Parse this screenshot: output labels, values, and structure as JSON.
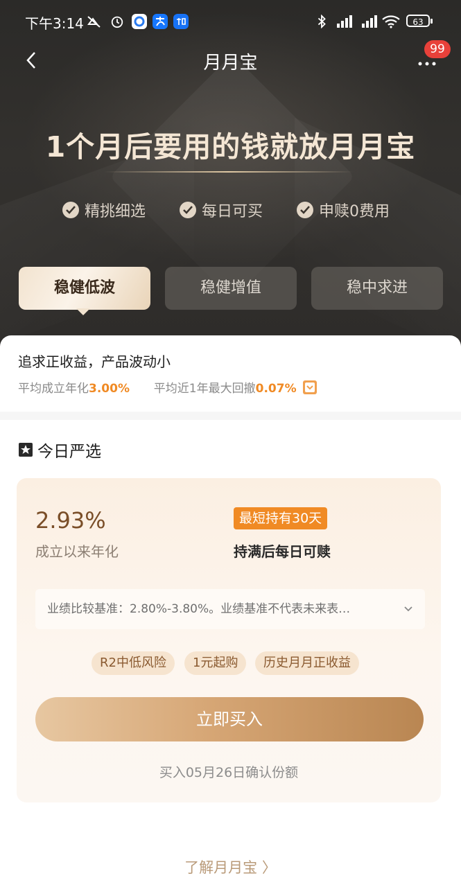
{
  "status_bar": {
    "time": "下午3:14",
    "battery": "63"
  },
  "nav": {
    "title": "月月宝",
    "badge": "99"
  },
  "hero": {
    "headline": "1个月后要用的钱就放月月宝",
    "features": [
      "精挑细选",
      "每日可买",
      "申赎0费用"
    ]
  },
  "tabs": [
    {
      "label": "稳健低波",
      "active": true
    },
    {
      "label": "稳健增值",
      "active": false
    },
    {
      "label": "稳中求进",
      "active": false
    }
  ],
  "desc": {
    "title": "追求正收益，产品波动小",
    "avg_label": "平均成立年化",
    "avg_value": "3.00%",
    "drawdown_label": "平均近1年最大回撤",
    "drawdown_value": "0.07%"
  },
  "section": {
    "title": "今日严选"
  },
  "product": {
    "rate": "2.93%",
    "rate_label": "成立以来年化",
    "hold_tag": "最短持有30天",
    "hold_text": "持满后每日可赎",
    "benchmark": "业绩比较基准：2.80%-3.80%。业绩基准不代表未来表…",
    "chips": [
      "R2中低风险",
      "1元起购",
      "历史月月正收益"
    ],
    "buy_label": "立即买入",
    "confirm_text": "买入05月26日确认份额"
  },
  "footer": {
    "learn_link": "了解月月宝 〉"
  },
  "colors": {
    "accent_orange": "#f08a24",
    "hero_bg": "#2e2c2a",
    "gold": "#d6a675"
  }
}
